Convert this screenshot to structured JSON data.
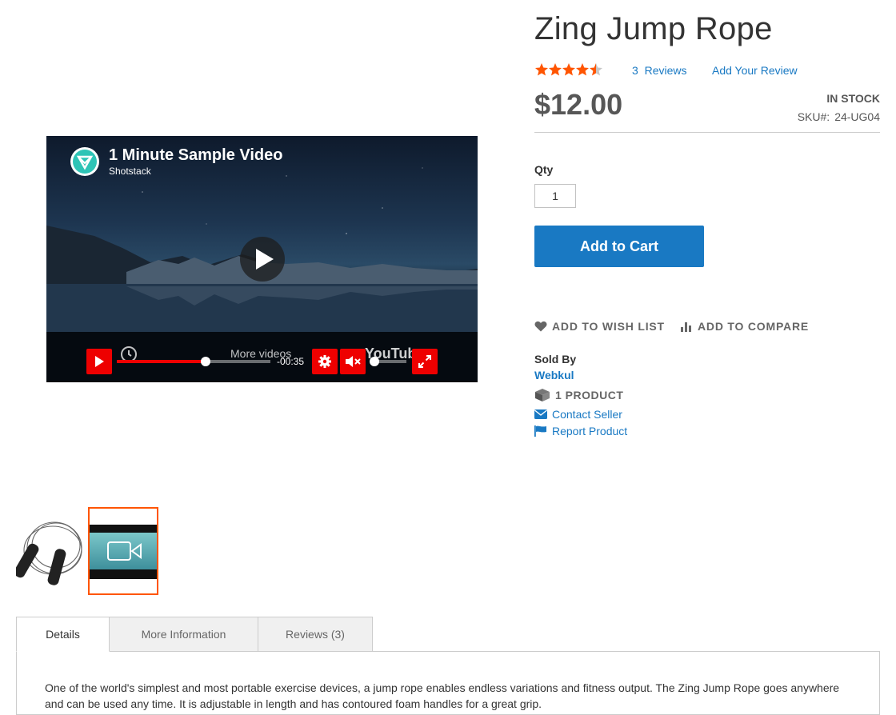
{
  "product": {
    "title": "Zing Jump Rope",
    "rating_stars": 4.5,
    "reviews_count": "3",
    "reviews_label": "Reviews",
    "add_review_label": "Add Your Review",
    "price": "$12.00",
    "stock": "IN STOCK",
    "sku_label": "SKU#:",
    "sku": "24-UG04"
  },
  "purchase": {
    "qty_label": "Qty",
    "qty_value": "1",
    "add_to_cart_label": "Add to Cart"
  },
  "actions": {
    "wish_list_label": "ADD TO WISH LIST",
    "compare_label": "ADD TO COMPARE",
    "wish_icon": "heart-icon",
    "compare_icon": "bar-chart-icon"
  },
  "seller": {
    "sold_by_label": "Sold By",
    "name": "Webkul",
    "product_count": "1 PRODUCT",
    "contact_label": "Contact Seller",
    "report_label": "Report Product"
  },
  "video": {
    "title": "1 Minute Sample Video",
    "channel": "Shotstack",
    "more_videos_label": "More videos",
    "time_remaining": "-00:35",
    "youtube_label": "YouTube",
    "progress_fraction": 0.58,
    "volume_fraction": 0.0
  },
  "tabs": [
    {
      "label": "Details",
      "active": true
    },
    {
      "label": "More Information",
      "active": false
    },
    {
      "label": "Reviews (3)",
      "active": false
    }
  ],
  "details": {
    "description": "One of the world's simplest and most portable exercise devices, a jump rope enables endless variations and fitness output. The Zing Jump Rope goes anywhere and can be used any time. It is adjustable in length and has contoured foam handles for a great grip."
  },
  "colors": {
    "accent": "#1979c3",
    "star": "#ff5501",
    "player_red": "#e00"
  }
}
